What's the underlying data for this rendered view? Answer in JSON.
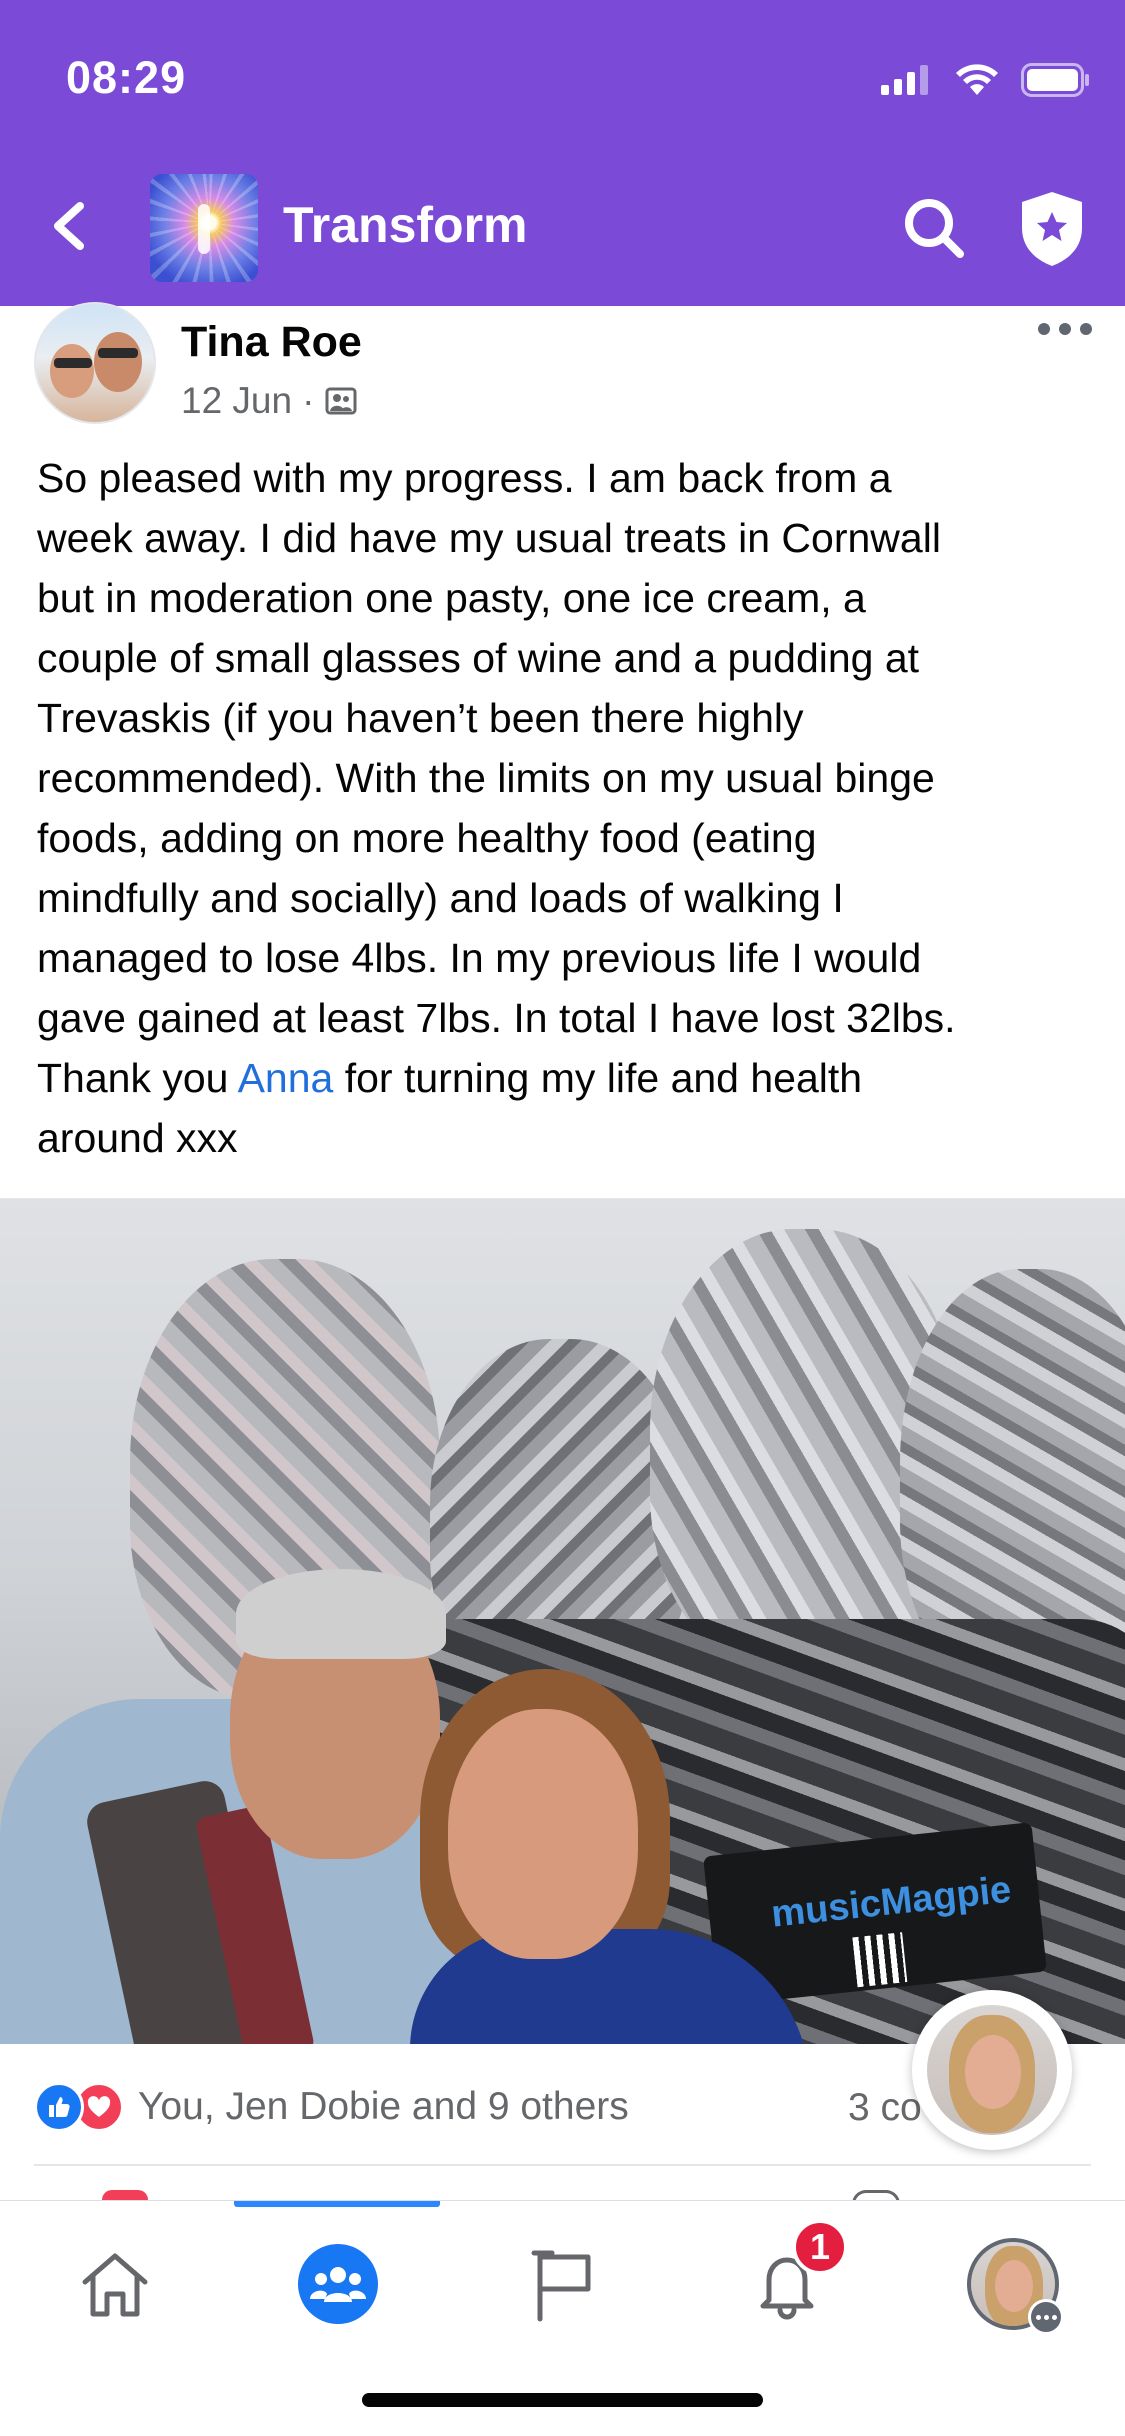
{
  "status_bar": {
    "time": "08:29"
  },
  "app_bar": {
    "title": "Transform"
  },
  "post": {
    "author": "Tina Roe",
    "date": "12 Jun",
    "separator": "·",
    "text_lines": [
      "So pleased with my progress. I am back from a",
      "week away. I did have my usual treats in Cornwall",
      "but in moderation one pasty, one ice cream, a",
      "couple of small glasses of wine and a pudding at",
      "Trevaskis (if you haven’t been there highly",
      "recommended). With the limits on my usual binge",
      "foods, adding on more healthy food (eating",
      "mindfully and socially) and loads of walking I",
      "managed to lose 4lbs. In my previous life I would",
      "gave gained at least 7lbs. In total I have lost 32lbs."
    ],
    "thanks_prefix": "Thank you ",
    "mention": "Anna",
    "thanks_suffix": " for turning my life and health",
    "last_line": "around xxx",
    "photo_sign": "musicMagpie",
    "reactions_text": "You, Jen Dobie and 9 others",
    "comments_text": "3 co",
    "comments_text_tail": "s"
  },
  "tab_bar": {
    "notification_count": "1"
  },
  "colors": {
    "brand_purple": "#7b4ad6",
    "link_blue": "#216fdb",
    "like_blue": "#1877f2",
    "love_red": "#f33e58",
    "badge_red": "#e41e3f"
  },
  "icons": {
    "status": [
      "signal-icon",
      "wifi-icon",
      "battery-icon"
    ],
    "app_bar": [
      "back-arrow-icon",
      "search-icon",
      "admin-shield-icon"
    ],
    "tabs": [
      "home-icon",
      "groups-icon",
      "pages-flag-icon",
      "bell-icon",
      "profile-avatar"
    ]
  }
}
